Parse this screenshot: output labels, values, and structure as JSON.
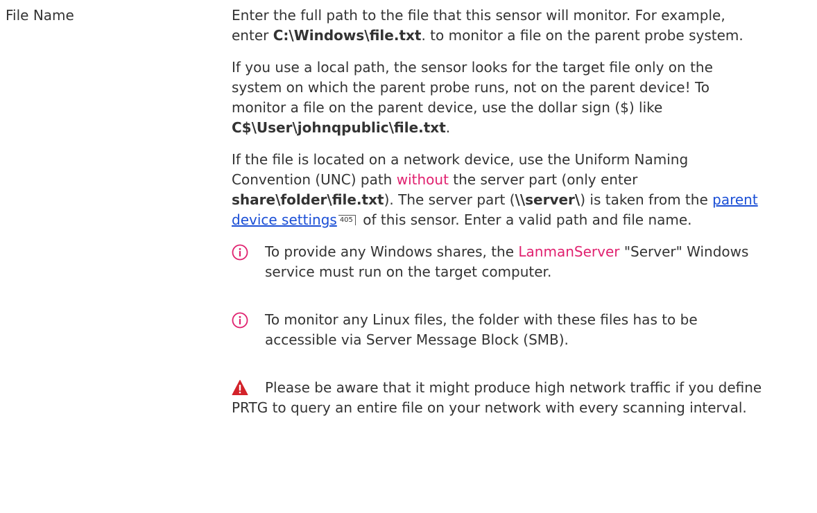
{
  "field": {
    "label": "File Name"
  },
  "description": {
    "p1": {
      "t1": "Enter the full path to the file that this sensor will monitor. For example, enter ",
      "b1": "C:\\Windows\\file.txt",
      "t2": ". to monitor a file on the parent probe system."
    },
    "p2": {
      "t1": "If you use a local path, the sensor looks for the target file only on the system on which the parent probe runs, not on the parent device! To monitor a file on the parent device, use the dollar sign ($) like ",
      "b1": "C$\\User\\johnqpublic\\file.txt",
      "t2": "."
    },
    "p3": {
      "t1": "If the file is located on a network device, use the Uniform Naming Convention (UNC) path ",
      "pink": "without",
      "t2": " the server part (only enter ",
      "b1": "share\\folder\\file.txt",
      "t3": "). The server part (",
      "b2": "\\\\server\\",
      "t4": ") is taken from the ",
      "link": "parent device settings",
      "page_ref": "405",
      "t5": " of this sensor. Enter a valid path and file name."
    }
  },
  "notes": [
    {
      "icon": "info-icon",
      "t1": "To provide any Windows shares, the ",
      "pink": "LanmanServer",
      "t2": " \"Server\" Windows service must run on the target computer."
    },
    {
      "icon": "info-icon",
      "text": "To monitor any Linux files, the folder with these files has to be accessible via Server Message Block (SMB)."
    }
  ],
  "warning": {
    "icon": "warning-icon",
    "text": "Please be aware that it might produce high network traffic if you define PRTG to query an entire file on your network with every scanning interval."
  },
  "colors": {
    "accent_pink": "#e0216f",
    "link_blue": "#1b4fd6",
    "info_icon": "#e0216f",
    "warning_icon": "#d3222a"
  }
}
